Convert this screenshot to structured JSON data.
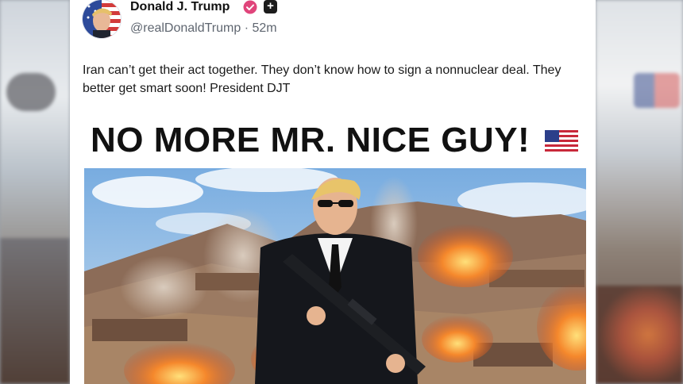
{
  "post": {
    "author_name": "Donald J. Trump",
    "handle": "@realDonaldTrump",
    "separator": "·",
    "time_ago": "52m",
    "text": "Iran can’t get their act together. They don’t know how to sign a nonnuclear deal. They better get smart soon! President DJT",
    "image_headline": "NO MORE MR. NICE GUY!"
  },
  "icons": {
    "verified": "verified-badge-icon",
    "plus": "plus-badge-icon",
    "flag": "us-flag-icon"
  },
  "colors": {
    "verified_badge": "#e0457b",
    "sky": "#8fbde6",
    "fire": "#f07a2a",
    "mountains": "#8a6a55"
  }
}
